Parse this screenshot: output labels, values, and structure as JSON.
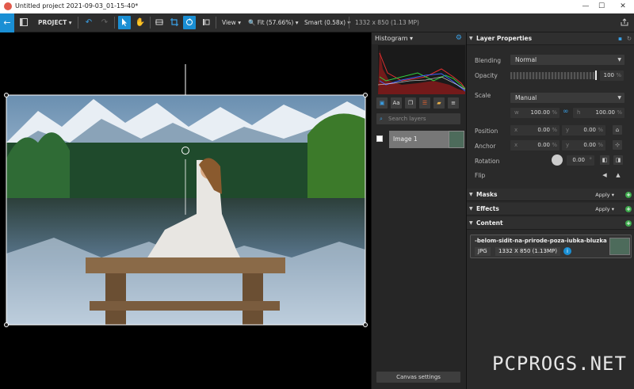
{
  "window": {
    "title": "Untitled project 2021-09-03_01-15-40*",
    "minimize": "—",
    "maximize": "☐",
    "close": "✕"
  },
  "toolbar": {
    "back_icon": "arrow-left-icon",
    "project_label": "PROJECT",
    "view_label": "View",
    "fit_label": "Fit (57.66%)",
    "smart_label": "Smart (0.58x)",
    "dimensions": "1332 x 850 (1.13 MP)",
    "accent": "#1a8fd4"
  },
  "histogram": {
    "title": "Histogram"
  },
  "layers": {
    "search_placeholder": "Search layers",
    "items": [
      {
        "name": "Image 1"
      }
    ],
    "canvas_settings": "Canvas settings"
  },
  "layer_properties": {
    "title": "Layer Properties",
    "blending_label": "Blending",
    "blending_value": "Normal",
    "opacity_label": "Opacity",
    "opacity_value": "100",
    "opacity_unit": "%",
    "scale_label": "Scale",
    "scale_mode": "Manual",
    "scale_w_prefix": "w",
    "scale_w": "100.00",
    "scale_h_prefix": "h",
    "scale_h": "100.00",
    "position_label": "Position",
    "position_x": "0.00",
    "position_y": "0.00",
    "anchor_label": "Anchor",
    "anchor_x": "0.00",
    "anchor_y": "0.00",
    "x_prefix": "x",
    "y_prefix": "y",
    "unit_percent": "%",
    "rotation_label": "Rotation",
    "rotation_value": "0.00",
    "rotation_unit": "°",
    "flip_label": "Flip"
  },
  "sections": {
    "masks": "Masks",
    "effects": "Effects",
    "content": "Content",
    "apply": "Apply"
  },
  "content": {
    "filename": "-belom-sidit-na-prirode-poza-iubka-bluzka",
    "format": "JPG",
    "size": "1332 X 850 (1.13MP)",
    "info_icon": "i"
  },
  "watermark": "PCPROGS.NET"
}
